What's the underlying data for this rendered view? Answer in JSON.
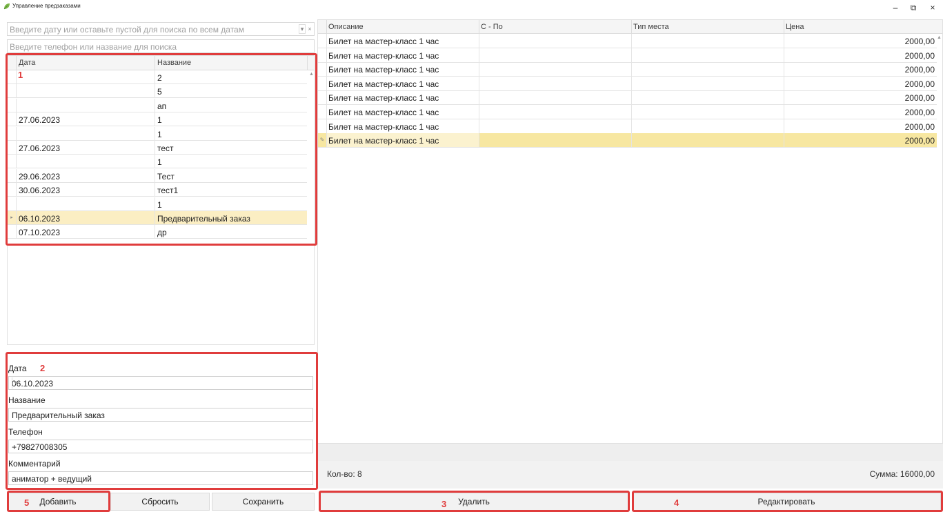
{
  "window": {
    "title": "Управление предзаказами",
    "minimize_glyph": "–",
    "restore_glyph": "⧉",
    "close_glyph": "×",
    "icon": "app-leaf-icon"
  },
  "search": {
    "date_placeholder": "Введите дату или оставьте пустой для поиска по всем датам",
    "phone_placeholder": "Введите телефон или название для поиска",
    "dropdown_glyph": "▾",
    "clear_glyph": "×"
  },
  "orders_grid": {
    "columns": [
      "Дата",
      "Название"
    ],
    "rows": [
      {
        "date": "",
        "name": "2"
      },
      {
        "date": "",
        "name": "5"
      },
      {
        "date": "",
        "name": "ап"
      },
      {
        "date": "27.06.2023",
        "name": "1"
      },
      {
        "date": "",
        "name": "1"
      },
      {
        "date": "27.06.2023",
        "name": "тест"
      },
      {
        "date": "",
        "name": "1"
      },
      {
        "date": "29.06.2023",
        "name": "Тест"
      },
      {
        "date": "30.06.2023",
        "name": "тест1"
      },
      {
        "date": "",
        "name": "1"
      },
      {
        "date": "06.10.2023",
        "name": "Предварительный заказ"
      },
      {
        "date": "07.10.2023",
        "name": "др"
      }
    ],
    "selected_index": 10,
    "current_indicator": "▸",
    "scroll_up_glyph": "▲"
  },
  "details": {
    "date_label": "Дата",
    "date_value": "06.10.2023",
    "name_label": "Название",
    "name_value": "Предварительный заказ",
    "phone_label": "Телефон",
    "phone_value": "+79827008305",
    "comment_label": "Комментарий",
    "comment_value": "аниматор + ведущий",
    "dropdown_glyph": "▾"
  },
  "buttons": {
    "add": "Добавить",
    "reset": "Сбросить",
    "save": "Сохранить",
    "delete": "Удалить",
    "edit": "Редактировать"
  },
  "items_grid": {
    "columns": [
      "Описание",
      "С - По",
      "Тип места",
      "Цена"
    ],
    "rows": [
      {
        "description": "Билет на мастер-класс 1 час",
        "from_to": "",
        "seat_type": "",
        "price": "2000,00"
      },
      {
        "description": "Билет на мастер-класс 1 час",
        "from_to": "",
        "seat_type": "",
        "price": "2000,00"
      },
      {
        "description": "Билет на мастер-класс 1 час",
        "from_to": "",
        "seat_type": "",
        "price": "2000,00"
      },
      {
        "description": "Билет на мастер-класс 1 час",
        "from_to": "",
        "seat_type": "",
        "price": "2000,00"
      },
      {
        "description": "Билет на мастер-класс 1 час",
        "from_to": "",
        "seat_type": "",
        "price": "2000,00"
      },
      {
        "description": "Билет на мастер-класс 1 час",
        "from_to": "",
        "seat_type": "",
        "price": "2000,00"
      },
      {
        "description": "Билет на мастер-класс 1 час",
        "from_to": "",
        "seat_type": "",
        "price": "2000,00"
      },
      {
        "description": "Билет на мастер-класс 1 час",
        "from_to": "",
        "seat_type": "",
        "price": "2000,00"
      }
    ],
    "selected_index": 7,
    "edit_indicator": "✎",
    "scroll_up_glyph": "▲",
    "scroll_down_glyph": "▼"
  },
  "summary": {
    "count_text": "Кол-во: 8",
    "total_text": "Сумма: 16000,00"
  },
  "annotations": {
    "labels": [
      "1",
      "2",
      "3",
      "4",
      "5"
    ],
    "color": "#e03c3c"
  },
  "colors": {
    "selected_row": "#fbeec3",
    "selected_item_row": "#f7e7a1",
    "annotation": "#e03c3c"
  }
}
